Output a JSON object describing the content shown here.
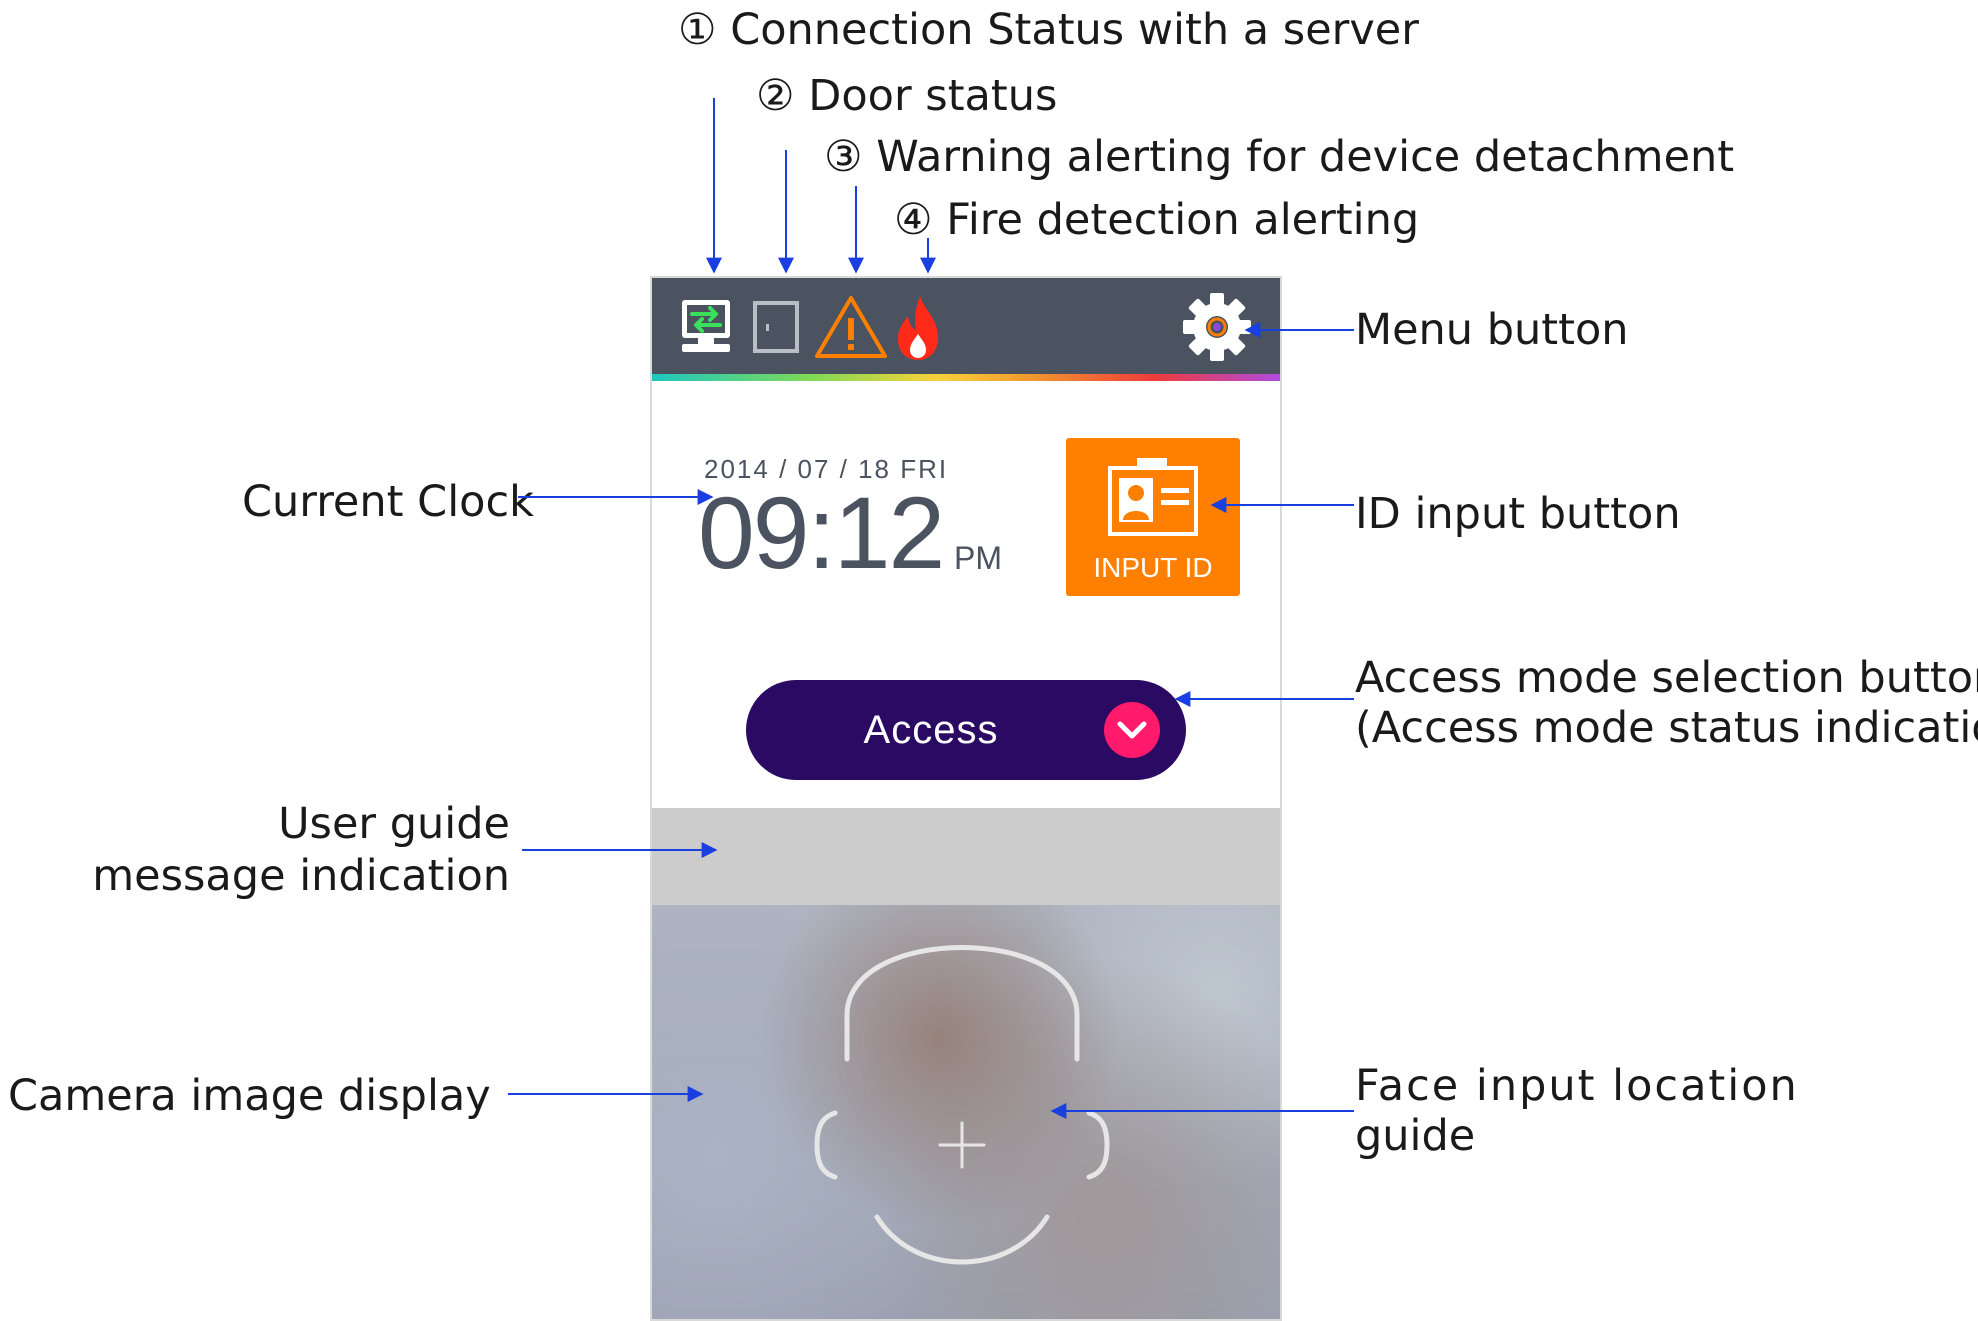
{
  "annotations": {
    "connection_status": "① Connection Status with a server",
    "door_status": "② Door status",
    "warning_detachment": "③ Warning alerting for device detachment",
    "fire_detection": "④ Fire detection alerting",
    "menu_button": "Menu button",
    "current_clock": "Current Clock",
    "id_input_button": "ID input button",
    "access_mode_line1": "Access mode selection button",
    "access_mode_line2": "(Access mode status indication)",
    "user_guide_line1": "User guide",
    "user_guide_line2": "message indication",
    "camera_image": "Camera image display",
    "face_guide_line1": "Face  input  location",
    "face_guide_line2": "guide"
  },
  "device": {
    "status_icons": [
      "connection-icon",
      "door-icon",
      "warning-icon",
      "fire-icon"
    ],
    "menu_icon": "gear-icon",
    "date": "2014 / 07 / 18 FRI",
    "time": "09:12",
    "ampm": "PM",
    "input_id_label": "INPUT ID",
    "access_label": "Access"
  },
  "colors": {
    "status_bar": "#4a535f",
    "connection_green": "#39e05a",
    "warning_orange": "#ff7f00",
    "fire_red": "#ff2a1a",
    "input_id_bg": "#ff7f00",
    "access_bg": "#2a0a63",
    "access_chevron_bg": "#ff1a6b",
    "guide_bar": "#cccccc",
    "arrow_blue": "#1a3fe0"
  }
}
